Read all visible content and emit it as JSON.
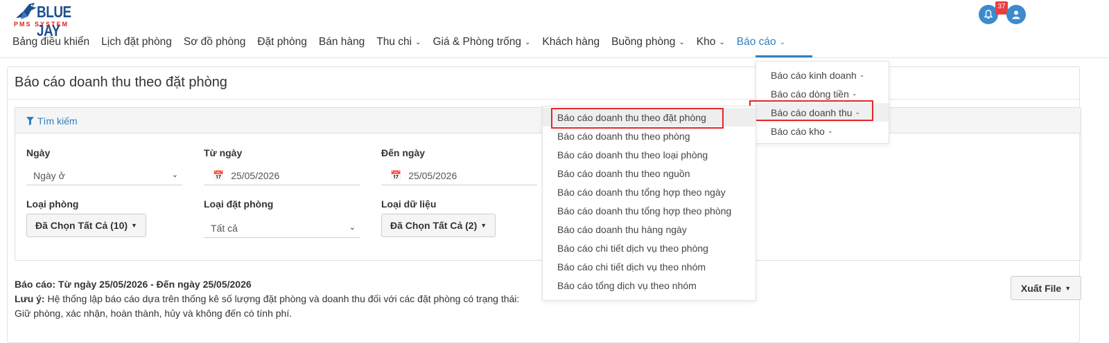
{
  "brand": {
    "title": "BLUE JAY",
    "subtitle": "PMS SYSTEM"
  },
  "notifications": {
    "count": "37"
  },
  "nav": {
    "items": [
      {
        "label": "Bảng điều khiển",
        "dropdown": false
      },
      {
        "label": "Lịch đặt phòng",
        "dropdown": false
      },
      {
        "label": "Sơ đồ phòng",
        "dropdown": false
      },
      {
        "label": "Đặt phòng",
        "dropdown": false
      },
      {
        "label": "Bán hàng",
        "dropdown": false
      },
      {
        "label": "Thu chi",
        "dropdown": true
      },
      {
        "label": "Giá & Phòng trống",
        "dropdown": true
      },
      {
        "label": "Khách hàng",
        "dropdown": false
      },
      {
        "label": "Buồng phòng",
        "dropdown": true
      },
      {
        "label": "Kho",
        "dropdown": true
      },
      {
        "label": "Báo cáo",
        "dropdown": true,
        "active": true
      }
    ]
  },
  "page": {
    "title": "Báo cáo doanh thu theo đặt phòng"
  },
  "search": {
    "title": "Tìm kiếm",
    "date_type_label": "Ngày",
    "date_type_value": "Ngày ở",
    "from_label": "Từ ngày",
    "from_value": "25/05/2026",
    "to_label": "Đến ngày",
    "to_value": "25/05/2026",
    "room_type_label": "Loại phòng",
    "room_type_value": "Đã Chọn Tất Cả (10)",
    "booking_type_label": "Loại đặt phòng",
    "booking_type_value": "Tất cả",
    "data_type_label": "Loại dữ liệu",
    "data_type_value": "Đã Chọn Tất Cả (2)"
  },
  "report": {
    "range_text": "Báo cáo: Từ ngày 25/05/2026 - Đến ngày 25/05/2026",
    "note_label": "Lưu ý:",
    "note_text": " Hệ thống lập báo cáo dựa trên thống kê số lượng đặt phòng và doanh thu đối với các đặt phòng có trạng thái:",
    "note_text2": "Giữ phòng, xác nhận, hoàn thành, hủy và không đến có tính phí.",
    "export_label": "Xuất File"
  },
  "menu_reports": {
    "items": [
      {
        "label": "Báo cáo kinh doanh"
      },
      {
        "label": "Báo cáo dòng tiền"
      },
      {
        "label": "Báo cáo doanh thu",
        "highlighted": true
      },
      {
        "label": "Báo cáo kho"
      }
    ]
  },
  "menu_revenue": {
    "items": [
      {
        "label": "Báo cáo doanh thu theo đặt phòng",
        "highlighted": true
      },
      {
        "label": "Báo cáo doanh thu theo phòng"
      },
      {
        "label": "Báo cáo doanh thu theo loại phòng"
      },
      {
        "label": "Báo cáo doanh thu theo nguồn"
      },
      {
        "label": "Báo cáo doanh thu tổng hợp theo ngày"
      },
      {
        "label": "Báo cáo doanh thu tổng hợp theo phòng"
      },
      {
        "label": "Báo cáo doanh thu hàng ngày"
      },
      {
        "label": "Báo cáo chi tiết dịch vụ theo phòng"
      },
      {
        "label": "Báo cáo chi tiết dịch vụ theo nhóm"
      },
      {
        "label": "Báo cáo tổng dịch vụ theo nhóm"
      }
    ]
  },
  "colors": {
    "accent": "#2f7fc1",
    "highlight_border": "#e3262a",
    "badge": "#ea3f3f"
  }
}
